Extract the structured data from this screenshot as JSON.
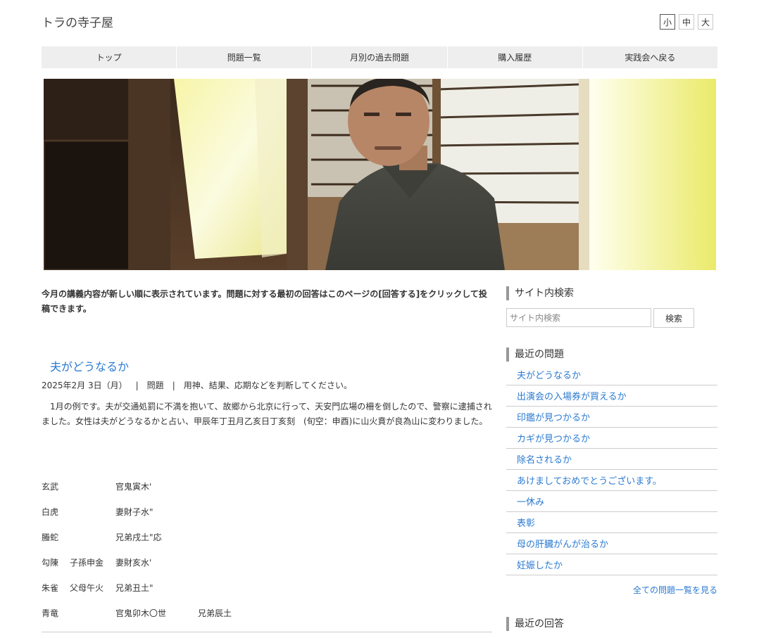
{
  "site": {
    "title": "トラの寺子屋"
  },
  "font_size": {
    "small": "小",
    "medium": "中",
    "large": "大"
  },
  "nav": [
    {
      "label": "トップ"
    },
    {
      "label": "問題一覧"
    },
    {
      "label": "月別の過去問題"
    },
    {
      "label": "購入履歴"
    },
    {
      "label": "実践会へ戻る"
    }
  ],
  "intro": "今月の講義内容が新しい順に表示されています。問題に対する最初の回答はこのページの[回答する]をクリックして投稿できます。",
  "post": {
    "title": "夫がどうなるか",
    "date": "2025年2月 3日（月）",
    "category": "問題",
    "tags": "用神、結果、応期などを判断してください。",
    "body": "1月の例です。夫が交通処罰に不満を抱いて、故郷から北京に行って、天安門広場の柵を倒したので、警察に逮捕されました。女性は夫がどうなるかと占い、甲辰年丁丑月乙亥日丁亥刻　(旬空：申酉)に山火賁が良為山に変わりました。",
    "hexagram": [
      {
        "god": "玄武",
        "hidden": "",
        "line": "官鬼寅木'",
        "change": ""
      },
      {
        "god": "白虎",
        "hidden": "",
        "line": "妻財子水\"",
        "change": ""
      },
      {
        "god": "螣蛇",
        "hidden": "",
        "line": "兄弟戌土\"応",
        "change": ""
      },
      {
        "god": "勾陳",
        "hidden": "子孫申金",
        "line": "妻財亥水'",
        "change": ""
      },
      {
        "god": "朱雀",
        "hidden": "父母午火",
        "line": "兄弟丑土\"",
        "change": ""
      },
      {
        "god": "青竜",
        "hidden": "",
        "line": "官鬼卯木〇世",
        "change": "兄弟辰土"
      }
    ]
  },
  "sidebar": {
    "search_heading": "サイト内検索",
    "search_placeholder": "サイト内検索",
    "search_button": "検索",
    "recent_heading": "最近の問題",
    "recent_items": [
      "夫がどうなるか",
      "出演会の入場券が買えるか",
      "印鑑が見つかるか",
      "カギが見つかるか",
      "除名されるか",
      "あけましておめでとうございます。",
      "一休み",
      "表彰",
      "母の肝臓がんが治るか",
      "妊娠したか"
    ],
    "all_link": "全ての問題一覧を見る",
    "answers_heading": "最近の回答"
  },
  "colors": {
    "link": "#2a7ad2",
    "nav_bg": "#eeeeee",
    "border": "#cccccc"
  }
}
